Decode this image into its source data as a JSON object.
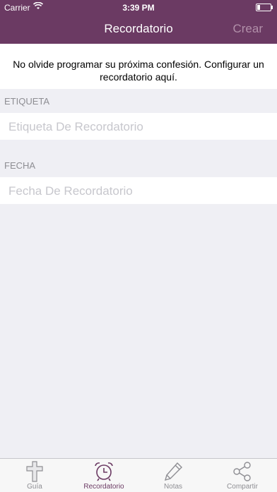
{
  "status_bar": {
    "carrier": "Carrier",
    "time": "3:39 PM"
  },
  "nav": {
    "title": "Recordatorio",
    "action": "Crear"
  },
  "message": "No olvide programar su próxima confesión. Configurar un recordatorio aquí.",
  "form": {
    "label_section": "ETIQUETA",
    "label_placeholder": "Etiqueta De Recordatorio",
    "date_section": "FECHA",
    "date_placeholder": "Fecha De Recordatorio"
  },
  "tabs": [
    {
      "label": "Guía",
      "icon": "cross-icon"
    },
    {
      "label": "Recordatorio",
      "icon": "alarm-clock-icon",
      "active": true
    },
    {
      "label": "Notas",
      "icon": "pencil-icon"
    },
    {
      "label": "Compartir",
      "icon": "share-icon"
    }
  ],
  "colors": {
    "accent": "#6b3a63",
    "background": "#efeff4",
    "placeholder": "#c7c7cd"
  }
}
